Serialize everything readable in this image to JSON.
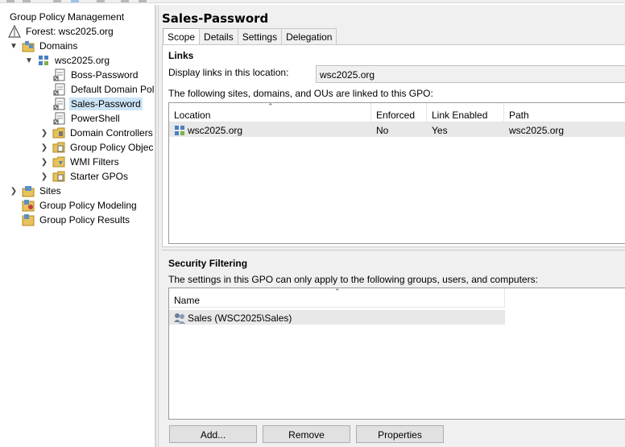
{
  "tree": {
    "root": "Group Policy Management",
    "forest": "Forest: wsc2025.org",
    "domains": "Domains",
    "domain": "wsc2025.org",
    "gpo_links": [
      "Boss-Password",
      "Default Domain Pol",
      "Sales-Password",
      "PowerShell"
    ],
    "containers": [
      "Domain Controllers",
      "Group Policy Objec",
      "WMI Filters",
      "Starter GPOs"
    ],
    "sites": "Sites",
    "modeling": "Group Policy Modeling",
    "results": "Group Policy Results",
    "selected": "Sales-Password"
  },
  "gpo": {
    "title": "Sales-Password",
    "tabs": [
      "Scope",
      "Details",
      "Settings",
      "Delegation"
    ],
    "active_tab": "Scope"
  },
  "links": {
    "heading": "Links",
    "display_label": "Display links in this location:",
    "display_value": "wsc2025.org",
    "desc": "The following sites, domains, and OUs are linked to this GPO:",
    "columns": [
      "Location",
      "Enforced",
      "Link Enabled",
      "Path"
    ],
    "rows": [
      {
        "location": "wsc2025.org",
        "enforced": "No",
        "link_enabled": "Yes",
        "path": "wsc2025.org"
      }
    ]
  },
  "security": {
    "heading": "Security Filtering",
    "desc": "The settings in this GPO can only apply to the following groups, users, and computers:",
    "column": "Name",
    "rows": [
      "Sales (WSC2025\\Sales)"
    ],
    "buttons": {
      "add": "Add...",
      "remove": "Remove",
      "properties": "Properties"
    }
  },
  "icons": {
    "tree_root": "management-console-icon",
    "forest": "forest-icon",
    "domains": "domains-folder-icon",
    "domain": "domain-icon",
    "gpo_link": "gpo-link-icon",
    "folder": "folder-icon",
    "group": "group-users-icon"
  },
  "colors": {
    "selection": "#cce4f7",
    "row_highlight": "#e8e8e8",
    "folder": "#e8c25a"
  }
}
